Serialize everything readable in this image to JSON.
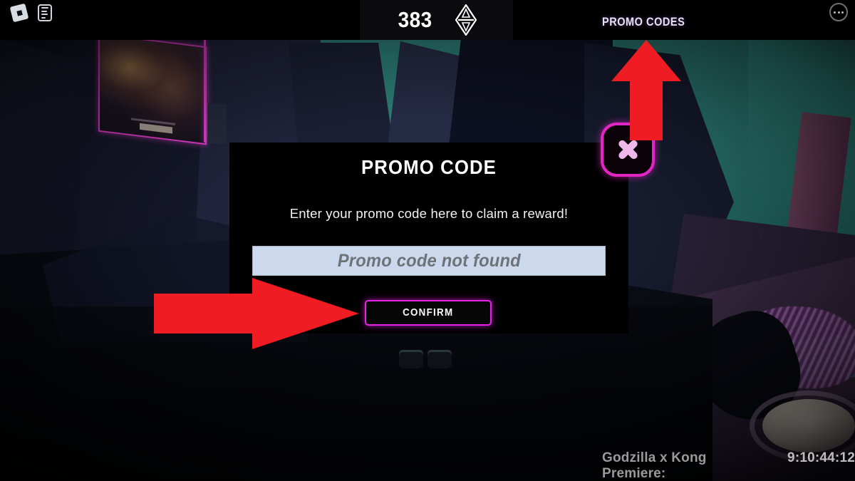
{
  "topbar": {
    "roblox_icon": "roblox-logo-icon",
    "menu_icon": "list-menu-icon",
    "currency_value": "383",
    "currency_icon": "gem-diamond-icon",
    "promo_codes_label": "PROMO CODES",
    "more_icon": "more-options-icon"
  },
  "modal": {
    "title": "PROMO CODE",
    "subtitle": "Enter your promo code here to claim a reward!",
    "input_value": "Promo code not found",
    "input_placeholder": "Promo code not found",
    "confirm_label": "CONFIRM",
    "close_icon": "close-x-icon"
  },
  "annotations": {
    "arrow_up_target": "PROMO CODES",
    "arrow_right_target": "CONFIRM",
    "arrow_color": "#ef1c23"
  },
  "footer": {
    "event_label": "Godzilla x Kong Premiere:",
    "countdown": "9:10:44:12"
  },
  "colors": {
    "accent_magenta": "#e722e7",
    "close_border": "#e325c6",
    "input_bg": "#ccd8ec",
    "input_text": "#6e7279",
    "modal_bg": "#010101",
    "teal_scene": "#2e7f78"
  }
}
